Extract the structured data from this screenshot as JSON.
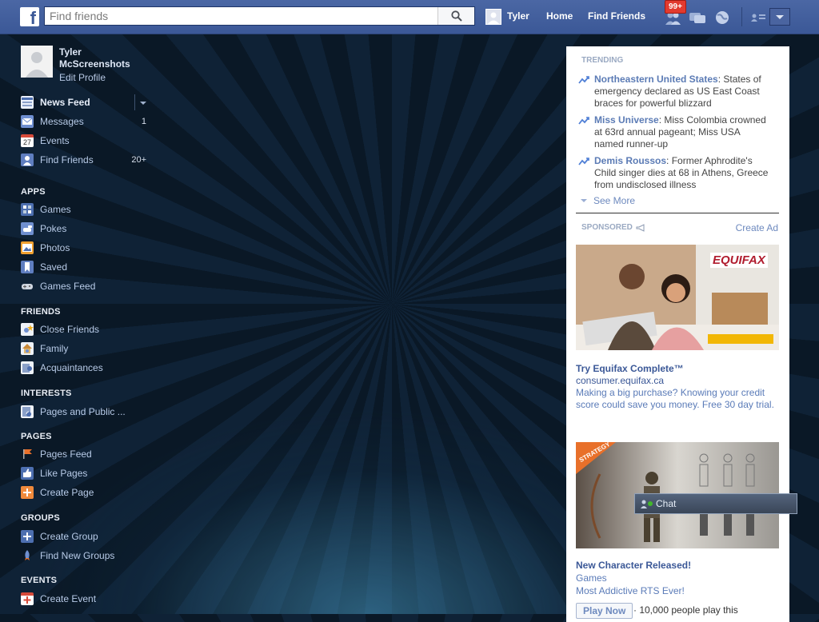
{
  "topbar": {
    "logo_letter": "f",
    "search_placeholder": "Find friends",
    "user_name": "Tyler",
    "home_label": "Home",
    "find_friends_label": "Find Friends",
    "notification_count": "99+"
  },
  "profile": {
    "name_line1": "Tyler",
    "name_line2": "McScreenshots",
    "edit_label": "Edit Profile"
  },
  "favorites": [
    {
      "label": "News Feed",
      "count": ""
    },
    {
      "label": "Messages",
      "count": "1"
    },
    {
      "label": "Events",
      "count": ""
    },
    {
      "label": "Find Friends",
      "count": "20+"
    }
  ],
  "events_icon_day": "27",
  "sections": {
    "apps": "APPS",
    "friends": "FRIENDS",
    "interests": "INTERESTS",
    "pages": "PAGES",
    "groups": "GROUPS",
    "events": "EVENTS"
  },
  "apps": [
    "Games",
    "Pokes",
    "Photos",
    "Saved",
    "Games Feed"
  ],
  "friends": [
    "Close Friends",
    "Family",
    "Acquaintances"
  ],
  "interests": [
    "Pages and Public ..."
  ],
  "pages": [
    "Pages Feed",
    "Like Pages",
    "Create Page"
  ],
  "groups": [
    "Create Group",
    "Find New Groups"
  ],
  "events": [
    "Create Event"
  ],
  "trending": {
    "heading": "TRENDING",
    "items": [
      {
        "topic": "Northeastern United States",
        "text": ": States of emergency declared as US East Coast braces for powerful blizzard"
      },
      {
        "topic": "Miss Universe",
        "text": ": Miss Colombia crowned at 63rd annual pageant; Miss USA named runner-up"
      },
      {
        "topic": "Demis Roussos",
        "text": ": Former Aphrodite's Child singer dies at 68 in Athens, Greece from undisclosed illness"
      }
    ],
    "see_more": "See More"
  },
  "sponsored": {
    "heading": "SPONSORED",
    "create_ad": "Create Ad",
    "ads": [
      {
        "logo_text": "EQUIFAX",
        "title": "Try Equifax Complete™",
        "url": "consumer.equifax.ca",
        "body": "Making a big purchase? Knowing your credit score could save you money. Free 30 day trial."
      },
      {
        "ribbon": "STRATEGY",
        "title": "New Character Released!",
        "category": "Games",
        "tagline": "Most Addictive RTS Ever!",
        "button": "Play Now",
        "social": "· 10,000 people play this"
      }
    ]
  },
  "chat": {
    "label": "Chat"
  },
  "colors": {
    "brand_blue": "#3b5897",
    "notification_red": "#e23a2f",
    "link_blue": "#6d89be"
  }
}
